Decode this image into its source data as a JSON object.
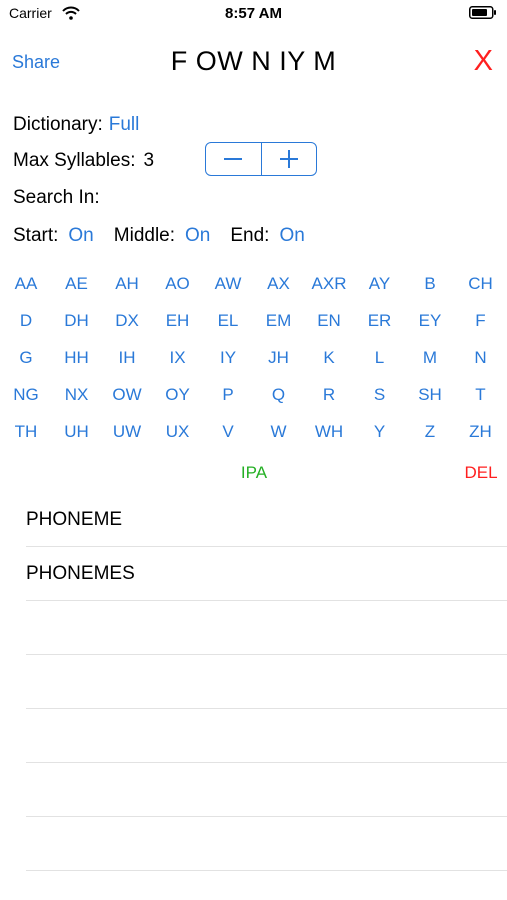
{
  "status": {
    "carrier": "Carrier",
    "time": "8:57 AM"
  },
  "nav": {
    "share": "Share",
    "title": "F OW N IY M",
    "close": "X"
  },
  "settings": {
    "dictionary_label": "Dictionary:",
    "dictionary_value": "Full",
    "syllables_label": "Max Syllables:",
    "syllables_value": "3",
    "stepper_minus": "−",
    "stepper_plus": "+",
    "search_in_label": "Search In:",
    "start_label": "Start:",
    "start_value": "On",
    "middle_label": "Middle:",
    "middle_value": "On",
    "end_label": "End:",
    "end_value": "On"
  },
  "phonemes": [
    [
      "AA",
      "AE",
      "AH",
      "AO",
      "AW",
      "AX",
      "AXR",
      "AY",
      "B",
      "CH"
    ],
    [
      "D",
      "DH",
      "DX",
      "EH",
      "EL",
      "EM",
      "EN",
      "ER",
      "EY",
      "F"
    ],
    [
      "G",
      "HH",
      "IH",
      "IX",
      "IY",
      "JH",
      "K",
      "L",
      "M",
      "N"
    ],
    [
      "NG",
      "NX",
      "OW",
      "OY",
      "P",
      "Q",
      "R",
      "S",
      "SH",
      "T"
    ],
    [
      "TH",
      "UH",
      "UW",
      "UX",
      "V",
      "W",
      "WH",
      "Y",
      "Z",
      "ZH"
    ]
  ],
  "keys": {
    "ipa": "IPA",
    "del": "DEL"
  },
  "results": [
    "PHONEME",
    "PHONEMES",
    "",
    "",
    "",
    "",
    ""
  ],
  "colors": {
    "accent": "#2a79d8",
    "close": "#ff1f1f",
    "ipa": "#25b025",
    "del": "#ff1f1f"
  }
}
